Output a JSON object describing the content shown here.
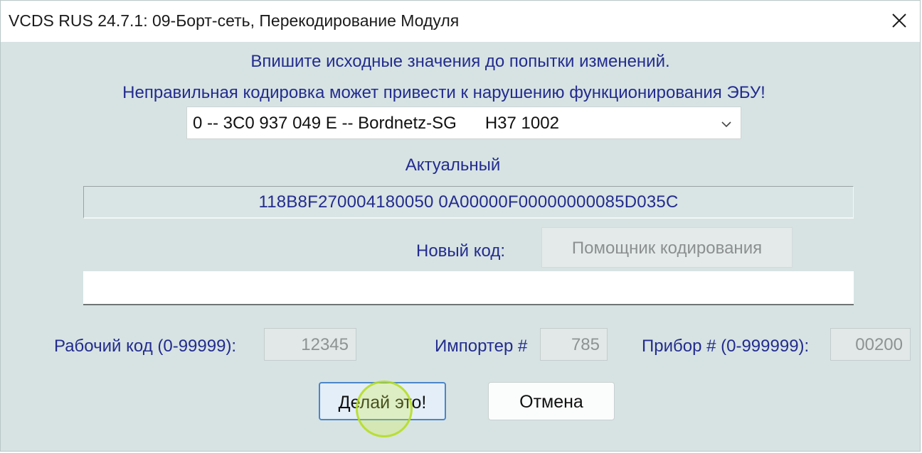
{
  "window": {
    "title": "VCDS RUS 24.7.1: 09-Борт-сеть,  Перекодирование Модуля"
  },
  "instructions": {
    "line1": "Впишите исходные значения до попытки изменений.",
    "line2": "Неправильная кодировка может привести к нарушению функционирования ЭБУ!"
  },
  "module_select": {
    "value": "0 -- 3C0 937 049 E -- Bordnetz-SG      H37 1002"
  },
  "actual": {
    "label": "Актуальный",
    "value": "118B8F270004180050 0A00000F00000000085D035C"
  },
  "new_code": {
    "label": "Новый код:",
    "helper_button": "Помощник кодирования",
    "value": ""
  },
  "workshop_code": {
    "label": "Рабочий код (0-99999):",
    "value": "12345"
  },
  "importer": {
    "label": "Импортер #",
    "value": "785"
  },
  "equipment": {
    "label": "Прибор # (0-999999):",
    "value": "00200"
  },
  "buttons": {
    "do_it": "Делай это!",
    "cancel": "Отмена"
  },
  "colors": {
    "accent_text": "#232c8e",
    "window_bg": "#d7e3e3",
    "focus_border": "#4a86c8"
  }
}
